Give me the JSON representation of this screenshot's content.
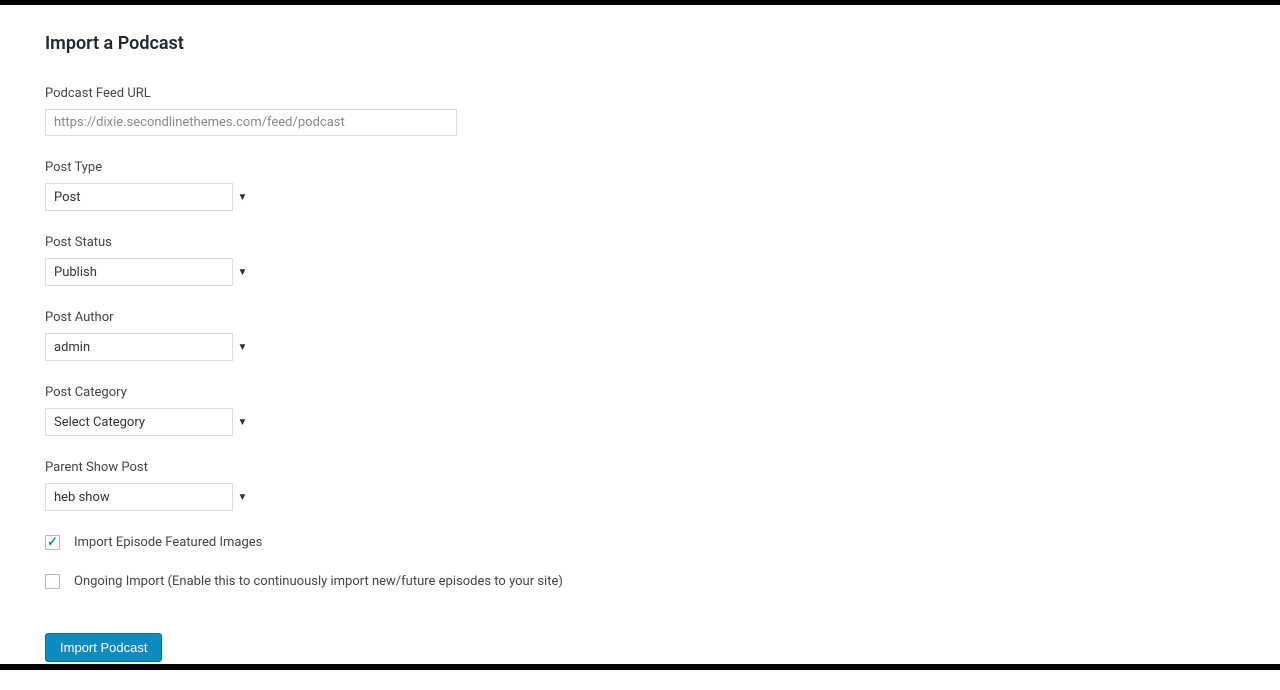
{
  "heading": "Import a Podcast",
  "fields": {
    "feed_url": {
      "label": "Podcast Feed URL",
      "value": "https://dixie.secondlinethemes.com/feed/podcast"
    },
    "post_type": {
      "label": "Post Type",
      "value": "Post"
    },
    "post_status": {
      "label": "Post Status",
      "value": "Publish"
    },
    "post_author": {
      "label": "Post Author",
      "value": "admin"
    },
    "post_category": {
      "label": "Post Category",
      "value": "Select Category"
    },
    "parent_show": {
      "label": "Parent Show Post",
      "value": "heb show"
    }
  },
  "checkboxes": {
    "featured_images": {
      "label": "Import Episode Featured Images",
      "checked": true
    },
    "ongoing_import": {
      "label": "Ongoing Import (Enable this to continuously import new/future episodes to your site)",
      "checked": false
    }
  },
  "submit_label": "Import Podcast"
}
